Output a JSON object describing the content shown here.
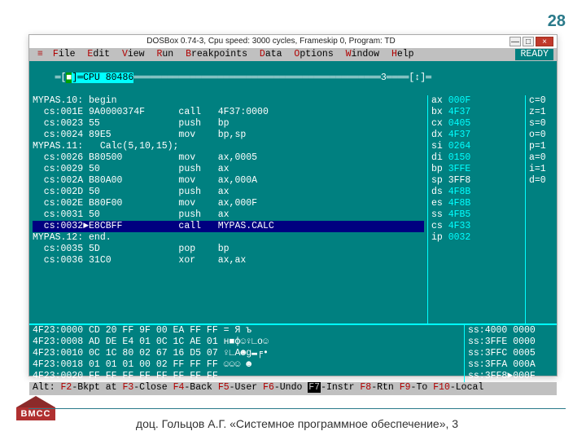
{
  "page_number": "28",
  "titlebar_text": "DOSBox 0.74-3, Cpu speed:    3000 cycles, Frameskip  0, Program:     TD",
  "tb_min": "—",
  "tb_max": "□",
  "tb_close": "×",
  "menu": {
    "sys": "≡",
    "items": [
      {
        "hot": "F",
        "rest": "ile"
      },
      {
        "hot": "E",
        "rest": "dit"
      },
      {
        "hot": "V",
        "rest": "iew"
      },
      {
        "hot": "R",
        "rest": "un"
      },
      {
        "hot": "B",
        "rest": "reakpoints"
      },
      {
        "hot": "D",
        "rest": "ata"
      },
      {
        "hot": "O",
        "rest": "ptions"
      },
      {
        "hot": "W",
        "rest": "indow"
      },
      {
        "hot": "H",
        "rest": "elp"
      }
    ],
    "ready": "READY"
  },
  "panel_header": {
    "prefix": "═[",
    "box": "■",
    "cpu": "]═CPU 80486",
    "fill": "════════════════════════════════════════════",
    "three": "3════",
    "suffix": "[↕]═"
  },
  "code": [
    {
      "text": "MYPAS.10: begin"
    },
    {
      "text": "  cs:001E 9A0000374F      call   4F37:0000"
    },
    {
      "text": "  cs:0023 55              push   bp"
    },
    {
      "text": "  cs:0024 89E5            mov    bp,sp"
    },
    {
      "text": "MYPAS.11:   Calc(5,10,15);"
    },
    {
      "text": "  cs:0026 B80500          mov    ax,0005"
    },
    {
      "text": "  cs:0029 50              push   ax"
    },
    {
      "text": "  cs:002A B80A00          mov    ax,000A"
    },
    {
      "text": "  cs:002D 50              push   ax"
    },
    {
      "text": "  cs:002E B80F00          mov    ax,000F"
    },
    {
      "text": "  cs:0031 50              push   ax"
    },
    {
      "text": "  cs:0032►E8CBFF          call   MYPAS.CALC",
      "hl": true
    },
    {
      "text": "MYPAS.12: end."
    },
    {
      "text": "  cs:0035 5D              pop    bp"
    },
    {
      "text": "  cs:0036 31C0            xor    ax,ax"
    }
  ],
  "regs": [
    {
      "name": "ax",
      "val": "000F"
    },
    {
      "name": "bx",
      "val": "4F37"
    },
    {
      "name": "cx",
      "val": "0405"
    },
    {
      "name": "dx",
      "val": "4F37"
    },
    {
      "name": "si",
      "val": "0264"
    },
    {
      "name": "di",
      "val": "0150"
    },
    {
      "name": "bp",
      "val": "3FFE"
    },
    {
      "name": "sp",
      "val": "3FF8",
      "hl": true
    },
    {
      "name": "ds",
      "val": "4F8B"
    },
    {
      "name": "es",
      "val": "4F8B"
    },
    {
      "name": "ss",
      "val": "4FB5"
    },
    {
      "name": "cs",
      "val": "4F33"
    },
    {
      "name": "ip",
      "val": "0032"
    }
  ],
  "flags": [
    {
      "f": "c",
      "v": "0"
    },
    {
      "f": "z",
      "v": "1"
    },
    {
      "f": "s",
      "v": "0"
    },
    {
      "f": "o",
      "v": "0"
    },
    {
      "f": "p",
      "v": "1"
    },
    {
      "f": "a",
      "v": "0"
    },
    {
      "f": "i",
      "v": "1"
    },
    {
      "f": "d",
      "v": "0"
    }
  ],
  "dump": [
    "4F23:0000 CD 20 FF 9F 00 EA FF FF = Я ъ",
    "4F23:0008 AD DE E4 01 0C 1C AE 01 н■ф☺♀∟о☺",
    "4F23:0010 0C 1C 80 02 67 16 D5 07 ♀∟А☻g▬╒•",
    "4F23:0018 01 01 01 00 02 FF FF FF ☺☺☺ ☻",
    "4F23:0020 FF FF FF FF FF FF FF FF"
  ],
  "stack": [
    "ss:4000 0000",
    "ss:3FFE 0000",
    "ss:3FFC 0005",
    "ss:3FFA 000A",
    "ss:3FF8►000F"
  ],
  "status_prefix": "Alt: ",
  "fkeys": [
    {
      "key": "F2",
      "label": "-Bkpt at "
    },
    {
      "key": "F3",
      "label": "-Close "
    },
    {
      "key": "F4",
      "label": "-Back "
    },
    {
      "key": "F5",
      "label": "-User "
    },
    {
      "key": "F6",
      "label": "-Undo "
    },
    {
      "key": "F7",
      "label": "-Instr ",
      "hl7": true
    },
    {
      "key": "F8",
      "label": "-Rtn "
    },
    {
      "key": "F9",
      "label": "-To "
    },
    {
      "key": "F10",
      "label": "-Local"
    }
  ],
  "footer_text": "доц. Гольцов А.Г.  «Системное программное обеспечение», 3",
  "logo_text": "ВМСС"
}
